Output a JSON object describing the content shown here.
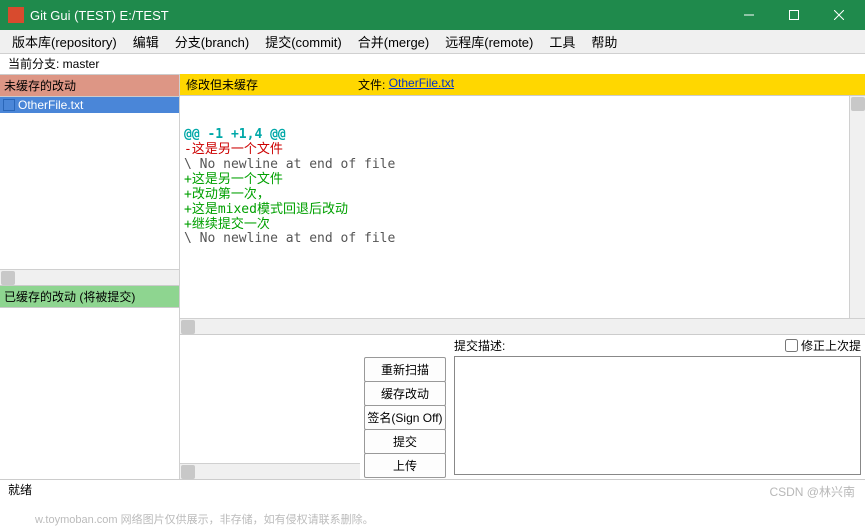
{
  "window": {
    "title": "Git Gui (TEST) E:/TEST"
  },
  "menu": {
    "repository": "版本库(repository)",
    "edit": "编辑",
    "branch": "分支(branch)",
    "commit": "提交(commit)",
    "merge": "合并(merge)",
    "remote": "远程库(remote)",
    "tools": "工具",
    "help": "帮助"
  },
  "branch_line": "当前分支: master",
  "panels": {
    "unstaged_title": "未缓存的改动",
    "staged_title": "已缓存的改动 (将被提交)"
  },
  "unstaged_files": [
    {
      "name": "OtherFile.txt"
    }
  ],
  "diff_header": {
    "left": "修改但未缓存",
    "file_label": "文件:",
    "file_name": "OtherFile.txt"
  },
  "diff_lines": [
    {
      "cls": "hunk",
      "text": "@@ -1 +1,4 @@"
    },
    {
      "cls": "del",
      "text": "-这是另一个文件"
    },
    {
      "cls": "ctx",
      "text": "\\ No newline at end of file"
    },
    {
      "cls": "add",
      "text": "+这是另一个文件"
    },
    {
      "cls": "add",
      "text": "+改动第一次，"
    },
    {
      "cls": "add",
      "text": "+这是mixed模式回退后改动"
    },
    {
      "cls": "add",
      "text": "+继续提交一次"
    },
    {
      "cls": "ctx",
      "text": "\\ No newline at end of file"
    }
  ],
  "commit": {
    "label": "提交描述:",
    "amend": "修正上次提",
    "buttons": {
      "rescan": "重新扫描",
      "stage": "缓存改动",
      "signoff": "签名(Sign Off)",
      "commit": "提交",
      "push": "上传"
    }
  },
  "status": "就绪",
  "watermark1": "w.toymoban.com  网络图片仅供展示，非存储，如有侵权请联系删除。",
  "watermark2": "CSDN @林兴南"
}
